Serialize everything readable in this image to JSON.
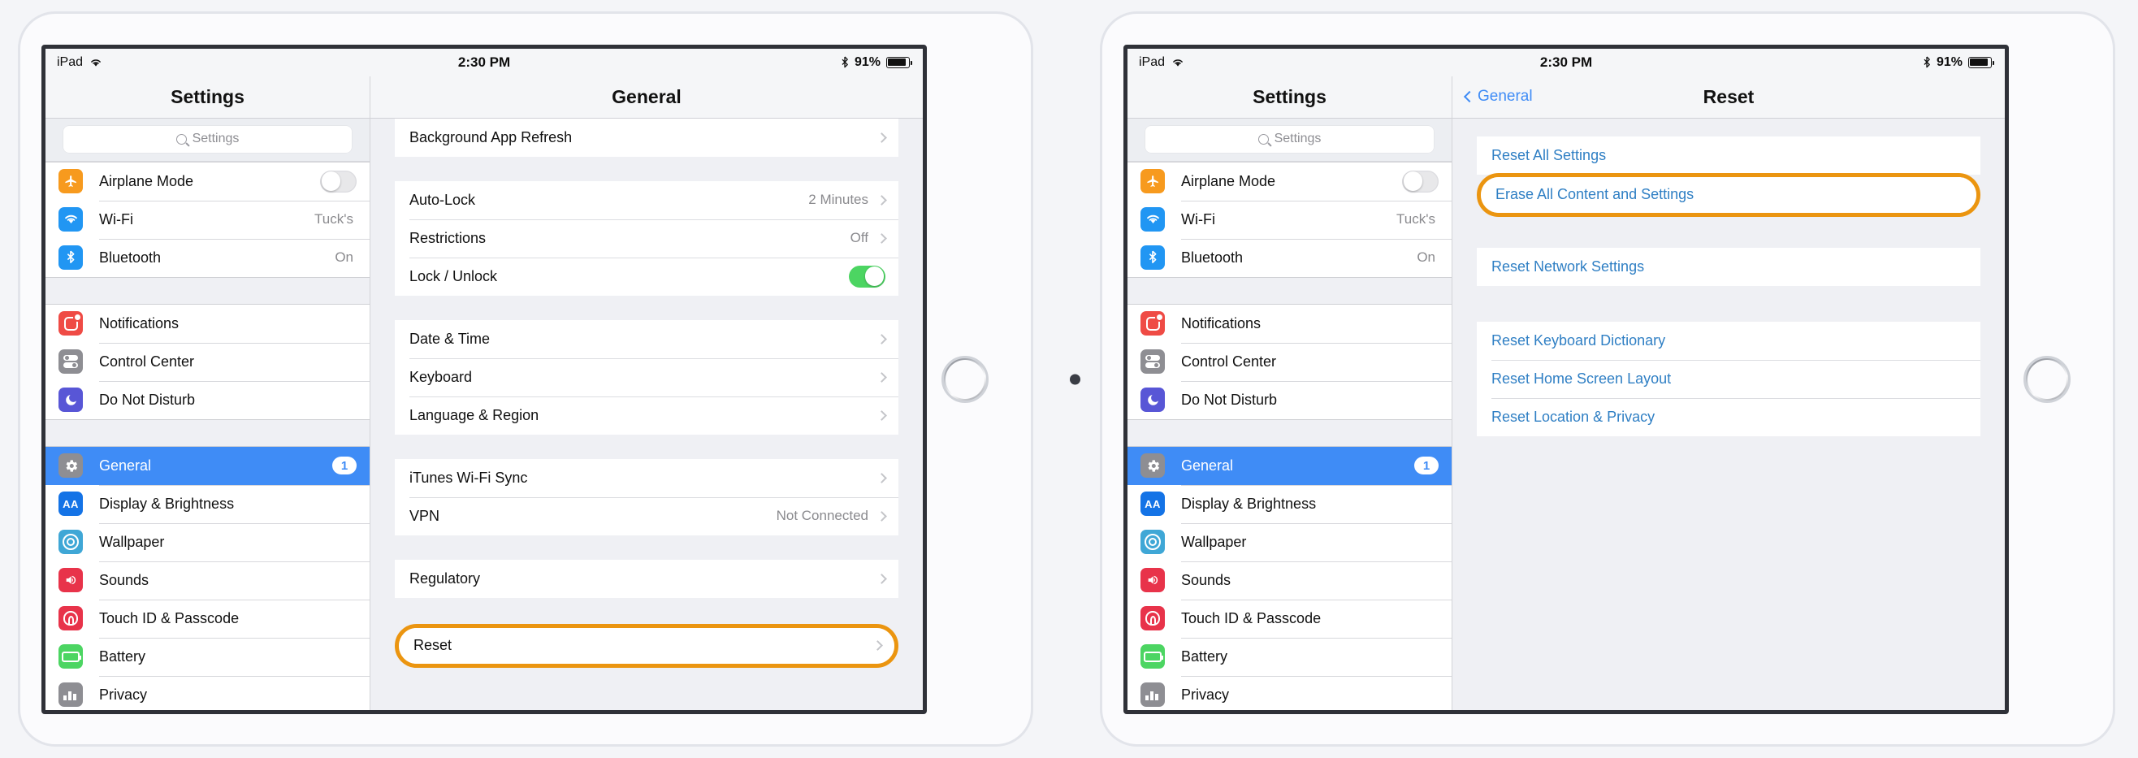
{
  "status_bar": {
    "device_label": "iPad",
    "wifi_icon": "wifi-icon",
    "time": "2:30 PM",
    "bluetooth_icon": "bluetooth-icon",
    "battery_percent": "91%"
  },
  "sidebar": {
    "title": "Settings",
    "search": {
      "placeholder": "Settings",
      "icon": "search-icon"
    },
    "groups": [
      {
        "items": [
          {
            "label": "Airplane Mode",
            "icon": "airplane-icon",
            "color": "#f79a1e",
            "control": "toggle",
            "toggle_on": false
          },
          {
            "label": "Wi-Fi",
            "icon": "wifi-icon",
            "color": "#2196f3",
            "value": "Tuck's"
          },
          {
            "label": "Bluetooth",
            "icon": "bluetooth-icon",
            "color": "#2196f3",
            "value": "On"
          }
        ]
      },
      {
        "items": [
          {
            "label": "Notifications",
            "icon": "notifications-icon",
            "color": "#ef4b45"
          },
          {
            "label": "Control Center",
            "icon": "control-center-icon",
            "color": "#8e8e93"
          },
          {
            "label": "Do Not Disturb",
            "icon": "do-not-disturb-icon",
            "color": "#5856d6"
          }
        ]
      },
      {
        "items": [
          {
            "label": "General",
            "icon": "gear-icon",
            "color": "#8e8e93",
            "selected": true,
            "badge": "1"
          },
          {
            "label": "Display & Brightness",
            "icon": "display-brightness-icon",
            "color": "#1473e6"
          },
          {
            "label": "Wallpaper",
            "icon": "wallpaper-icon",
            "color": "#3fa7d6"
          },
          {
            "label": "Sounds",
            "icon": "sounds-icon",
            "color": "#e8334a"
          },
          {
            "label": "Touch ID & Passcode",
            "icon": "touch-id-icon",
            "color": "#e8334a"
          },
          {
            "label": "Battery",
            "icon": "battery-icon",
            "color": "#4cd562"
          },
          {
            "label": "Privacy",
            "icon": "privacy-icon",
            "color": "#8e8e93"
          }
        ]
      }
    ]
  },
  "left_detail": {
    "title": "General",
    "groups": [
      {
        "rows": [
          {
            "label": "Background App Refresh",
            "chevron": true
          }
        ]
      },
      {
        "rows": [
          {
            "label": "Auto-Lock",
            "value": "2 Minutes",
            "chevron": true
          },
          {
            "label": "Restrictions",
            "value": "Off",
            "chevron": true
          },
          {
            "label": "Lock / Unlock",
            "control": "toggle",
            "toggle_on": true
          }
        ]
      },
      {
        "rows": [
          {
            "label": "Date & Time",
            "chevron": true
          },
          {
            "label": "Keyboard",
            "chevron": true
          },
          {
            "label": "Language & Region",
            "chevron": true
          }
        ]
      },
      {
        "rows": [
          {
            "label": "iTunes Wi-Fi Sync",
            "chevron": true
          },
          {
            "label": "VPN",
            "value": "Not Connected",
            "chevron": true
          }
        ]
      },
      {
        "rows": [
          {
            "label": "Regulatory",
            "chevron": true
          }
        ]
      }
    ],
    "highlighted_row": {
      "label": "Reset",
      "chevron": true,
      "highlight_color": "#eb9510"
    }
  },
  "right_detail": {
    "back_label": "General",
    "title": "Reset",
    "group_a": [
      {
        "label": "Reset All Settings",
        "link": true
      }
    ],
    "highlighted_row": {
      "label": "Erase All Content and Settings",
      "link": true,
      "highlight_color": "#eb9510"
    },
    "group_b": [
      {
        "label": "Reset Network Settings",
        "link": true
      }
    ],
    "group_c": [
      {
        "label": "Reset Keyboard Dictionary",
        "link": true
      },
      {
        "label": "Reset Home Screen Layout",
        "link": true
      },
      {
        "label": "Reset Location & Privacy",
        "link": true
      }
    ]
  }
}
